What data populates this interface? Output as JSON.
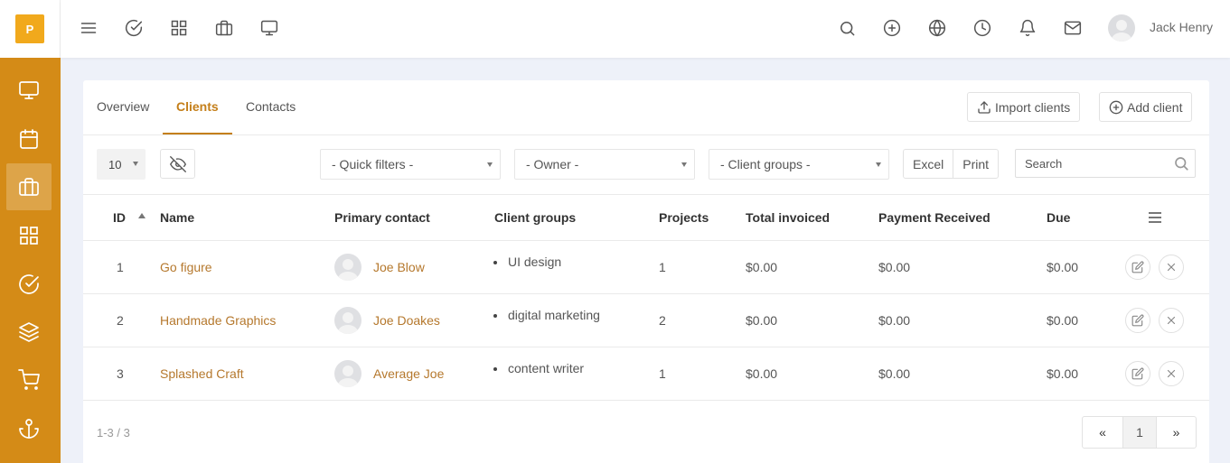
{
  "app": {
    "logo_letter": "P"
  },
  "sidebar": {
    "items": [
      {
        "icon": "monitor-icon",
        "active": false
      },
      {
        "icon": "calendar-icon",
        "active": false
      },
      {
        "icon": "briefcase-icon",
        "active": true
      },
      {
        "icon": "grid-icon",
        "active": false
      },
      {
        "icon": "check-circle-icon",
        "active": false
      },
      {
        "icon": "layers-icon",
        "active": false
      },
      {
        "icon": "cart-icon",
        "active": false
      },
      {
        "icon": "anchor-icon",
        "active": false
      }
    ]
  },
  "topbar": {
    "left_icons": [
      "menu-icon",
      "check-circle-icon",
      "grid-icon",
      "briefcase-icon",
      "monitor-icon"
    ],
    "right_icons": [
      "search-icon",
      "plus-circle-icon",
      "globe-icon",
      "clock-icon",
      "bell-icon",
      "mail-icon"
    ],
    "user_name": "Jack Henry"
  },
  "tabs": {
    "overview": "Overview",
    "clients": "Clients",
    "contacts": "Contacts",
    "active": "Clients"
  },
  "actions": {
    "import_label": "Import clients",
    "add_label": "Add client"
  },
  "toolbar": {
    "page_size": "10",
    "quick_filters": "- Quick filters -",
    "owner": "- Owner -",
    "client_groups": "- Client groups -",
    "excel": "Excel",
    "print": "Print",
    "search_placeholder": "Search"
  },
  "table": {
    "headers": {
      "id": "ID",
      "name": "Name",
      "primary_contact": "Primary contact",
      "client_groups": "Client groups",
      "projects": "Projects",
      "total_invoiced": "Total invoiced",
      "payment_received": "Payment Received",
      "due": "Due"
    },
    "rows": [
      {
        "id": "1",
        "name": "Go figure",
        "contact": "Joe Blow",
        "group": "UI design",
        "projects": "1",
        "total_invoiced": "$0.00",
        "payment_received": "$0.00",
        "due": "$0.00"
      },
      {
        "id": "2",
        "name": "Handmade Graphics",
        "contact": "Joe Doakes",
        "group": "digital marketing",
        "projects": "2",
        "total_invoiced": "$0.00",
        "payment_received": "$0.00",
        "due": "$0.00"
      },
      {
        "id": "3",
        "name": "Splashed Craft",
        "contact": "Average Joe",
        "group": "content writer",
        "projects": "1",
        "total_invoiced": "$0.00",
        "payment_received": "$0.00",
        "due": "$0.00"
      }
    ]
  },
  "footer": {
    "range": "1-3 / 3",
    "prev": "«",
    "page": "1",
    "next": "»"
  },
  "colors": {
    "sidebar": "#d48b17",
    "accent": "#c47f1a",
    "link": "#b5782d",
    "logo": "#f1a91c"
  }
}
